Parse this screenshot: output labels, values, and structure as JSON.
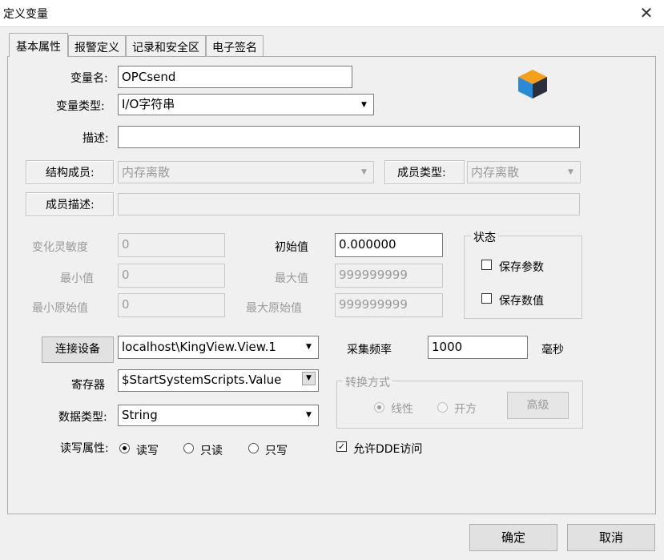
{
  "window": {
    "title": "定义变量",
    "close_glyph": "✕"
  },
  "tabs": [
    {
      "label": "基本属性",
      "active": true
    },
    {
      "label": "报警定义",
      "active": false
    },
    {
      "label": "记录和安全区",
      "active": false
    },
    {
      "label": "电子签名",
      "active": false
    }
  ],
  "fields": {
    "var_name_label": "变量名:",
    "var_name_value": "OPCsend",
    "var_type_label": "变量类型:",
    "var_type_value": "I/O字符串",
    "desc_label": "描述:",
    "desc_value": "",
    "struct_member_label": "结构成员:",
    "struct_member_value": "内存离散",
    "member_type_label": "成员类型:",
    "member_type_value": "内存离散",
    "member_desc_label": "成员描述:",
    "member_desc_value": ""
  },
  "values": {
    "sensitivity_label": "变化灵敏度",
    "sensitivity_value": "0",
    "min_label": "最小值",
    "min_value": "0",
    "min_raw_label": "最小原始值",
    "min_raw_value": "0",
    "initial_label": "初始值",
    "initial_value": "0.000000",
    "max_label": "最大值",
    "max_value": "999999999",
    "max_raw_label": "最大原始值",
    "max_raw_value": "999999999"
  },
  "status_group": {
    "title": "状态",
    "save_params_label": "保存参数",
    "save_params_checked": false,
    "save_value_label": "保存数值",
    "save_value_checked": false
  },
  "io": {
    "connect_button": "连接设备",
    "device_value": "localhost\\KingView.View.1",
    "sample_rate_label": "采集频率",
    "sample_rate_value": "1000",
    "sample_rate_unit": "毫秒",
    "register_label": "寄存器",
    "register_value": "$StartSystemScripts.Value",
    "data_type_label": "数据类型:",
    "data_type_value": "String",
    "rw_label": "读写属性:",
    "rw_options": [
      "读写",
      "只读",
      "只写"
    ],
    "rw_selected": "读写",
    "dde_label": "允许DDE访问",
    "dde_checked": true
  },
  "conversion_group": {
    "title": "转换方式",
    "linear_label": "线性",
    "sqrt_label": "开方",
    "advanced_button": "高级",
    "selected": "线性"
  },
  "footer": {
    "ok_button": "确定",
    "cancel_button": "取消"
  },
  "icons": {
    "cube": "cube-icon",
    "dropdown": "▼",
    "check": "✓"
  },
  "colors": {
    "cube_top": "#f5a01c",
    "cube_left": "#2a8ad8",
    "cube_right": "#2b2f3a"
  }
}
